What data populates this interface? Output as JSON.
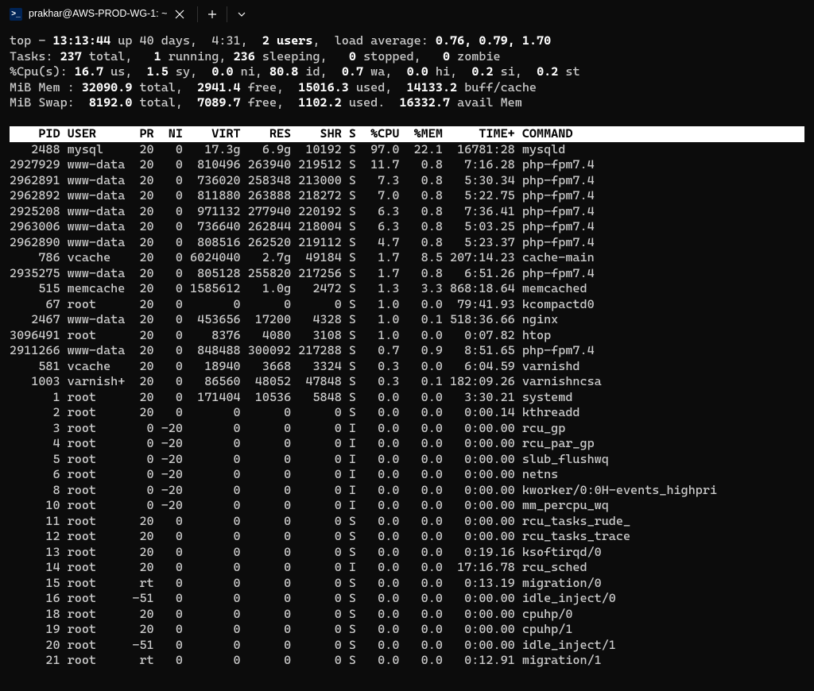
{
  "tab": {
    "title": "prakhar@AWS-PROD-WG-1: ~",
    "icon_label": ">_"
  },
  "summary": {
    "line1": {
      "prefix": "top - ",
      "time": "13:13:44",
      "uptime": " up 40 days,  4:31,  ",
      "users": "2 users",
      "loadavg_label": ",  load average: ",
      "loadavg": "0.76, 0.79, 1.70"
    },
    "line2": {
      "label": "Tasks: ",
      "total": "237 ",
      "total_lbl": "total,   ",
      "running": "1 ",
      "running_lbl": "running, ",
      "sleeping": "236 ",
      "sleeping_lbl": "sleeping,   ",
      "stopped": "0 ",
      "stopped_lbl": "stopped,   ",
      "zombie": "0 ",
      "zombie_lbl": "zombie"
    },
    "line3": {
      "label": "%Cpu(s): ",
      "us": "16.7 ",
      "us_lbl": "us,  ",
      "sy": "1.5 ",
      "sy_lbl": "sy,  ",
      "ni": "0.0 ",
      "ni_lbl": "ni, ",
      "id": "80.8 ",
      "id_lbl": "id,  ",
      "wa": "0.7 ",
      "wa_lbl": "wa,  ",
      "hi": "0.0 ",
      "hi_lbl": "hi,  ",
      "si": "0.2 ",
      "si_lbl": "si,  ",
      "st": "0.2 ",
      "st_lbl": "st"
    },
    "line4": {
      "label": "MiB Mem : ",
      "total": "32090.9 ",
      "total_lbl": "total,  ",
      "free": "2941.4 ",
      "free_lbl": "free,  ",
      "used": "15016.3 ",
      "used_lbl": "used,  ",
      "buff": "14133.2 ",
      "buff_lbl": "buff/cache"
    },
    "line5": {
      "label": "MiB Swap:  ",
      "total": "8192.0 ",
      "total_lbl": "total,  ",
      "free": "7089.7 ",
      "free_lbl": "free,  ",
      "used": "1102.2 ",
      "used_lbl": "used.  ",
      "avail": "16332.7 ",
      "avail_lbl": "avail Mem"
    }
  },
  "header": "    PID USER      PR  NI    VIRT    RES    SHR S  %CPU  %MEM     TIME+ COMMAND                      ",
  "rows": [
    {
      "pid": "2488",
      "user": "mysql",
      "pr": "20",
      "ni": "0",
      "virt": "17.3g",
      "res": "6.9g",
      "shr": "10192",
      "s": "S",
      "cpu": "97.0",
      "mem": "22.1",
      "time": "16781:28",
      "cmd": "mysqld"
    },
    {
      "pid": "2927929",
      "user": "www-data",
      "pr": "20",
      "ni": "0",
      "virt": "810496",
      "res": "263940",
      "shr": "219512",
      "s": "S",
      "cpu": "11.7",
      "mem": "0.8",
      "time": "7:16.28",
      "cmd": "php-fpm7.4"
    },
    {
      "pid": "2962891",
      "user": "www-data",
      "pr": "20",
      "ni": "0",
      "virt": "736020",
      "res": "258348",
      "shr": "213000",
      "s": "S",
      "cpu": "7.3",
      "mem": "0.8",
      "time": "5:30.34",
      "cmd": "php-fpm7.4"
    },
    {
      "pid": "2962892",
      "user": "www-data",
      "pr": "20",
      "ni": "0",
      "virt": "811880",
      "res": "263888",
      "shr": "218272",
      "s": "S",
      "cpu": "7.0",
      "mem": "0.8",
      "time": "5:22.75",
      "cmd": "php-fpm7.4"
    },
    {
      "pid": "2925208",
      "user": "www-data",
      "pr": "20",
      "ni": "0",
      "virt": "971132",
      "res": "277940",
      "shr": "220192",
      "s": "S",
      "cpu": "6.3",
      "mem": "0.8",
      "time": "7:36.41",
      "cmd": "php-fpm7.4"
    },
    {
      "pid": "2963006",
      "user": "www-data",
      "pr": "20",
      "ni": "0",
      "virt": "736640",
      "res": "262844",
      "shr": "218004",
      "s": "S",
      "cpu": "6.3",
      "mem": "0.8",
      "time": "5:03.25",
      "cmd": "php-fpm7.4"
    },
    {
      "pid": "2962890",
      "user": "www-data",
      "pr": "20",
      "ni": "0",
      "virt": "808516",
      "res": "262520",
      "shr": "219112",
      "s": "S",
      "cpu": "4.7",
      "mem": "0.8",
      "time": "5:23.37",
      "cmd": "php-fpm7.4"
    },
    {
      "pid": "786",
      "user": "vcache",
      "pr": "20",
      "ni": "0",
      "virt": "6024040",
      "res": "2.7g",
      "shr": "49184",
      "s": "S",
      "cpu": "1.7",
      "mem": "8.5",
      "time": "207:14.23",
      "cmd": "cache-main"
    },
    {
      "pid": "2935275",
      "user": "www-data",
      "pr": "20",
      "ni": "0",
      "virt": "805128",
      "res": "255820",
      "shr": "217256",
      "s": "S",
      "cpu": "1.7",
      "mem": "0.8",
      "time": "6:51.26",
      "cmd": "php-fpm7.4"
    },
    {
      "pid": "515",
      "user": "memcache",
      "pr": "20",
      "ni": "0",
      "virt": "1585612",
      "res": "1.0g",
      "shr": "2472",
      "s": "S",
      "cpu": "1.3",
      "mem": "3.3",
      "time": "868:18.64",
      "cmd": "memcached"
    },
    {
      "pid": "67",
      "user": "root",
      "pr": "20",
      "ni": "0",
      "virt": "0",
      "res": "0",
      "shr": "0",
      "s": "S",
      "cpu": "1.0",
      "mem": "0.0",
      "time": "79:41.93",
      "cmd": "kcompactd0"
    },
    {
      "pid": "2467",
      "user": "www-data",
      "pr": "20",
      "ni": "0",
      "virt": "453656",
      "res": "17200",
      "shr": "4328",
      "s": "S",
      "cpu": "1.0",
      "mem": "0.1",
      "time": "518:36.66",
      "cmd": "nginx"
    },
    {
      "pid": "3096491",
      "user": "root",
      "pr": "20",
      "ni": "0",
      "virt": "8376",
      "res": "4080",
      "shr": "3108",
      "s": "S",
      "cpu": "1.0",
      "mem": "0.0",
      "time": "0:07.82",
      "cmd": "htop"
    },
    {
      "pid": "2911266",
      "user": "www-data",
      "pr": "20",
      "ni": "0",
      "virt": "848488",
      "res": "300092",
      "shr": "217288",
      "s": "S",
      "cpu": "0.7",
      "mem": "0.9",
      "time": "8:51.65",
      "cmd": "php-fpm7.4"
    },
    {
      "pid": "581",
      "user": "vcache",
      "pr": "20",
      "ni": "0",
      "virt": "18940",
      "res": "3668",
      "shr": "3324",
      "s": "S",
      "cpu": "0.3",
      "mem": "0.0",
      "time": "6:04.59",
      "cmd": "varnishd"
    },
    {
      "pid": "1003",
      "user": "varnish+",
      "pr": "20",
      "ni": "0",
      "virt": "86560",
      "res": "48052",
      "shr": "47848",
      "s": "S",
      "cpu": "0.3",
      "mem": "0.1",
      "time": "182:09.26",
      "cmd": "varnishncsa"
    },
    {
      "pid": "1",
      "user": "root",
      "pr": "20",
      "ni": "0",
      "virt": "171404",
      "res": "10536",
      "shr": "5848",
      "s": "S",
      "cpu": "0.0",
      "mem": "0.0",
      "time": "3:30.21",
      "cmd": "systemd"
    },
    {
      "pid": "2",
      "user": "root",
      "pr": "20",
      "ni": "0",
      "virt": "0",
      "res": "0",
      "shr": "0",
      "s": "S",
      "cpu": "0.0",
      "mem": "0.0",
      "time": "0:00.14",
      "cmd": "kthreadd"
    },
    {
      "pid": "3",
      "user": "root",
      "pr": "0",
      "ni": "-20",
      "virt": "0",
      "res": "0",
      "shr": "0",
      "s": "I",
      "cpu": "0.0",
      "mem": "0.0",
      "time": "0:00.00",
      "cmd": "rcu_gp"
    },
    {
      "pid": "4",
      "user": "root",
      "pr": "0",
      "ni": "-20",
      "virt": "0",
      "res": "0",
      "shr": "0",
      "s": "I",
      "cpu": "0.0",
      "mem": "0.0",
      "time": "0:00.00",
      "cmd": "rcu_par_gp"
    },
    {
      "pid": "5",
      "user": "root",
      "pr": "0",
      "ni": "-20",
      "virt": "0",
      "res": "0",
      "shr": "0",
      "s": "I",
      "cpu": "0.0",
      "mem": "0.0",
      "time": "0:00.00",
      "cmd": "slub_flushwq"
    },
    {
      "pid": "6",
      "user": "root",
      "pr": "0",
      "ni": "-20",
      "virt": "0",
      "res": "0",
      "shr": "0",
      "s": "I",
      "cpu": "0.0",
      "mem": "0.0",
      "time": "0:00.00",
      "cmd": "netns"
    },
    {
      "pid": "8",
      "user": "root",
      "pr": "0",
      "ni": "-20",
      "virt": "0",
      "res": "0",
      "shr": "0",
      "s": "I",
      "cpu": "0.0",
      "mem": "0.0",
      "time": "0:00.00",
      "cmd": "kworker/0:0H-events_highpri"
    },
    {
      "pid": "10",
      "user": "root",
      "pr": "0",
      "ni": "-20",
      "virt": "0",
      "res": "0",
      "shr": "0",
      "s": "I",
      "cpu": "0.0",
      "mem": "0.0",
      "time": "0:00.00",
      "cmd": "mm_percpu_wq"
    },
    {
      "pid": "11",
      "user": "root",
      "pr": "20",
      "ni": "0",
      "virt": "0",
      "res": "0",
      "shr": "0",
      "s": "S",
      "cpu": "0.0",
      "mem": "0.0",
      "time": "0:00.00",
      "cmd": "rcu_tasks_rude_"
    },
    {
      "pid": "12",
      "user": "root",
      "pr": "20",
      "ni": "0",
      "virt": "0",
      "res": "0",
      "shr": "0",
      "s": "S",
      "cpu": "0.0",
      "mem": "0.0",
      "time": "0:00.00",
      "cmd": "rcu_tasks_trace"
    },
    {
      "pid": "13",
      "user": "root",
      "pr": "20",
      "ni": "0",
      "virt": "0",
      "res": "0",
      "shr": "0",
      "s": "S",
      "cpu": "0.0",
      "mem": "0.0",
      "time": "0:19.16",
      "cmd": "ksoftirqd/0"
    },
    {
      "pid": "14",
      "user": "root",
      "pr": "20",
      "ni": "0",
      "virt": "0",
      "res": "0",
      "shr": "0",
      "s": "I",
      "cpu": "0.0",
      "mem": "0.0",
      "time": "17:16.78",
      "cmd": "rcu_sched"
    },
    {
      "pid": "15",
      "user": "root",
      "pr": "rt",
      "ni": "0",
      "virt": "0",
      "res": "0",
      "shr": "0",
      "s": "S",
      "cpu": "0.0",
      "mem": "0.0",
      "time": "0:13.19",
      "cmd": "migration/0"
    },
    {
      "pid": "16",
      "user": "root",
      "pr": "-51",
      "ni": "0",
      "virt": "0",
      "res": "0",
      "shr": "0",
      "s": "S",
      "cpu": "0.0",
      "mem": "0.0",
      "time": "0:00.00",
      "cmd": "idle_inject/0"
    },
    {
      "pid": "18",
      "user": "root",
      "pr": "20",
      "ni": "0",
      "virt": "0",
      "res": "0",
      "shr": "0",
      "s": "S",
      "cpu": "0.0",
      "mem": "0.0",
      "time": "0:00.00",
      "cmd": "cpuhp/0"
    },
    {
      "pid": "19",
      "user": "root",
      "pr": "20",
      "ni": "0",
      "virt": "0",
      "res": "0",
      "shr": "0",
      "s": "S",
      "cpu": "0.0",
      "mem": "0.0",
      "time": "0:00.00",
      "cmd": "cpuhp/1"
    },
    {
      "pid": "20",
      "user": "root",
      "pr": "-51",
      "ni": "0",
      "virt": "0",
      "res": "0",
      "shr": "0",
      "s": "S",
      "cpu": "0.0",
      "mem": "0.0",
      "time": "0:00.00",
      "cmd": "idle_inject/1"
    },
    {
      "pid": "21",
      "user": "root",
      "pr": "rt",
      "ni": "0",
      "virt": "0",
      "res": "0",
      "shr": "0",
      "s": "S",
      "cpu": "0.0",
      "mem": "0.0",
      "time": "0:12.91",
      "cmd": "migration/1"
    }
  ]
}
